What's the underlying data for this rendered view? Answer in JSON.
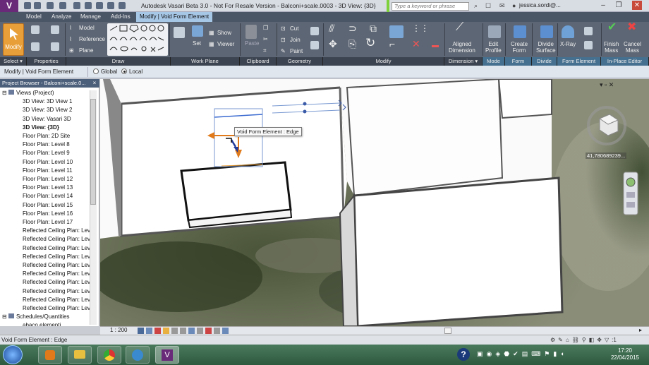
{
  "window": {
    "title": "Autodesk Vasari Beta 3.0 - Not For Resale Version -   Balconi+scale.0003 - 3D View: {3D}",
    "search_placeholder": "Type a keyword or phrase",
    "user": "jessica.sordi@..."
  },
  "tabs": [
    {
      "label": "Model"
    },
    {
      "label": "Analyze"
    },
    {
      "label": "Manage"
    },
    {
      "label": "Add-Ins"
    },
    {
      "label": "Modify | Void Form Element"
    }
  ],
  "ribbon": {
    "modify_label": "Modify",
    "draw": {
      "model": "Model",
      "reference": "Reference",
      "plane": "Plane"
    },
    "workplane": {
      "set": "Set",
      "show": "Show",
      "viewer": "Viewer"
    },
    "clipboard": {
      "paste": "Paste"
    },
    "geometry": {
      "cut": "Cut",
      "join": "Join",
      "paint": "Paint"
    },
    "dimension": {
      "aligned": "Aligned\nDimension"
    },
    "mode": {
      "edit_profile": "Edit\nProfile"
    },
    "form": {
      "create_form": "Create\nForm"
    },
    "divide": {
      "divide_surface": "Divide\nSurface"
    },
    "form_element": {
      "xray": "X-Ray"
    },
    "inplace": {
      "finish": "Finish\nMass",
      "cancel": "Cancel\nMass"
    },
    "panels": [
      "Select ▾",
      "Properties",
      "Draw",
      "Work Plane",
      "Clipboard",
      "Geometry",
      "Modify",
      "Dimension ▾",
      "Mode",
      "Form",
      "Divide",
      "Form Element",
      "In-Place Editor"
    ]
  },
  "options_bar": {
    "context": "Modify | Void Form Element",
    "global": "Global",
    "local": "Local"
  },
  "project_browser": {
    "title": "Project Browser - Balconi+scale.0...",
    "close": "×",
    "items": [
      {
        "label": "Views (Project)",
        "indent": 0,
        "bold": false,
        "expander": "⊟"
      },
      {
        "label": "3D View: 3D View 1",
        "indent": 1,
        "bold": false
      },
      {
        "label": "3D View: 3D View 2",
        "indent": 1,
        "bold": false
      },
      {
        "label": "3D View: Vasari 3D",
        "indent": 1,
        "bold": false
      },
      {
        "label": "3D View: {3D}",
        "indent": 1,
        "bold": true
      },
      {
        "label": "Floor Plan: 2D Site",
        "indent": 1,
        "bold": false
      },
      {
        "label": "Floor Plan: Level 8",
        "indent": 1,
        "bold": false
      },
      {
        "label": "Floor Plan: Level 9",
        "indent": 1,
        "bold": false
      },
      {
        "label": "Floor Plan: Level 10",
        "indent": 1,
        "bold": false
      },
      {
        "label": "Floor Plan: Level 11",
        "indent": 1,
        "bold": false
      },
      {
        "label": "Floor Plan: Level 12",
        "indent": 1,
        "bold": false
      },
      {
        "label": "Floor Plan: Level 13",
        "indent": 1,
        "bold": false
      },
      {
        "label": "Floor Plan: Level 14",
        "indent": 1,
        "bold": false
      },
      {
        "label": "Floor Plan: Level 15",
        "indent": 1,
        "bold": false
      },
      {
        "label": "Floor Plan: Level 16",
        "indent": 1,
        "bold": false
      },
      {
        "label": "Floor Plan: Level 17",
        "indent": 1,
        "bold": false
      },
      {
        "label": "Reflected Ceiling Plan: Lev",
        "indent": 1,
        "bold": false
      },
      {
        "label": "Reflected Ceiling Plan: Lev",
        "indent": 1,
        "bold": false
      },
      {
        "label": "Reflected Ceiling Plan: Lev",
        "indent": 1,
        "bold": false
      },
      {
        "label": "Reflected Ceiling Plan: Lev",
        "indent": 1,
        "bold": false
      },
      {
        "label": "Reflected Ceiling Plan: Lev",
        "indent": 1,
        "bold": false
      },
      {
        "label": "Reflected Ceiling Plan: Lev",
        "indent": 1,
        "bold": false
      },
      {
        "label": "Reflected Ceiling Plan: Lev",
        "indent": 1,
        "bold": false
      },
      {
        "label": "Reflected Ceiling Plan: Lev",
        "indent": 1,
        "bold": false
      },
      {
        "label": "Reflected Ceiling Plan: Lev",
        "indent": 1,
        "bold": false
      },
      {
        "label": "Reflected Ceiling Plan: Lev",
        "indent": 1,
        "bold": false
      },
      {
        "label": "Schedules/Quantities",
        "indent": 0,
        "bold": false,
        "expander": "⊟"
      },
      {
        "label": "abaco elementi",
        "indent": 1,
        "bold": false
      }
    ]
  },
  "viewport": {
    "tooltip": "Void Form Element : Edge",
    "coordinate": "41,780689239...",
    "controls": "▾ ▫ ✕"
  },
  "view_control": {
    "scale": "1 : 200"
  },
  "status": {
    "text": "Void Form Element : Edge",
    "filter_count": ":1"
  },
  "taskbar": {
    "time": "17:20",
    "date": "22/04/2015"
  },
  "colors": {
    "accent": "#e89f3a",
    "active_tab": "#a7c7e7",
    "ribbon": "#5d6674"
  }
}
